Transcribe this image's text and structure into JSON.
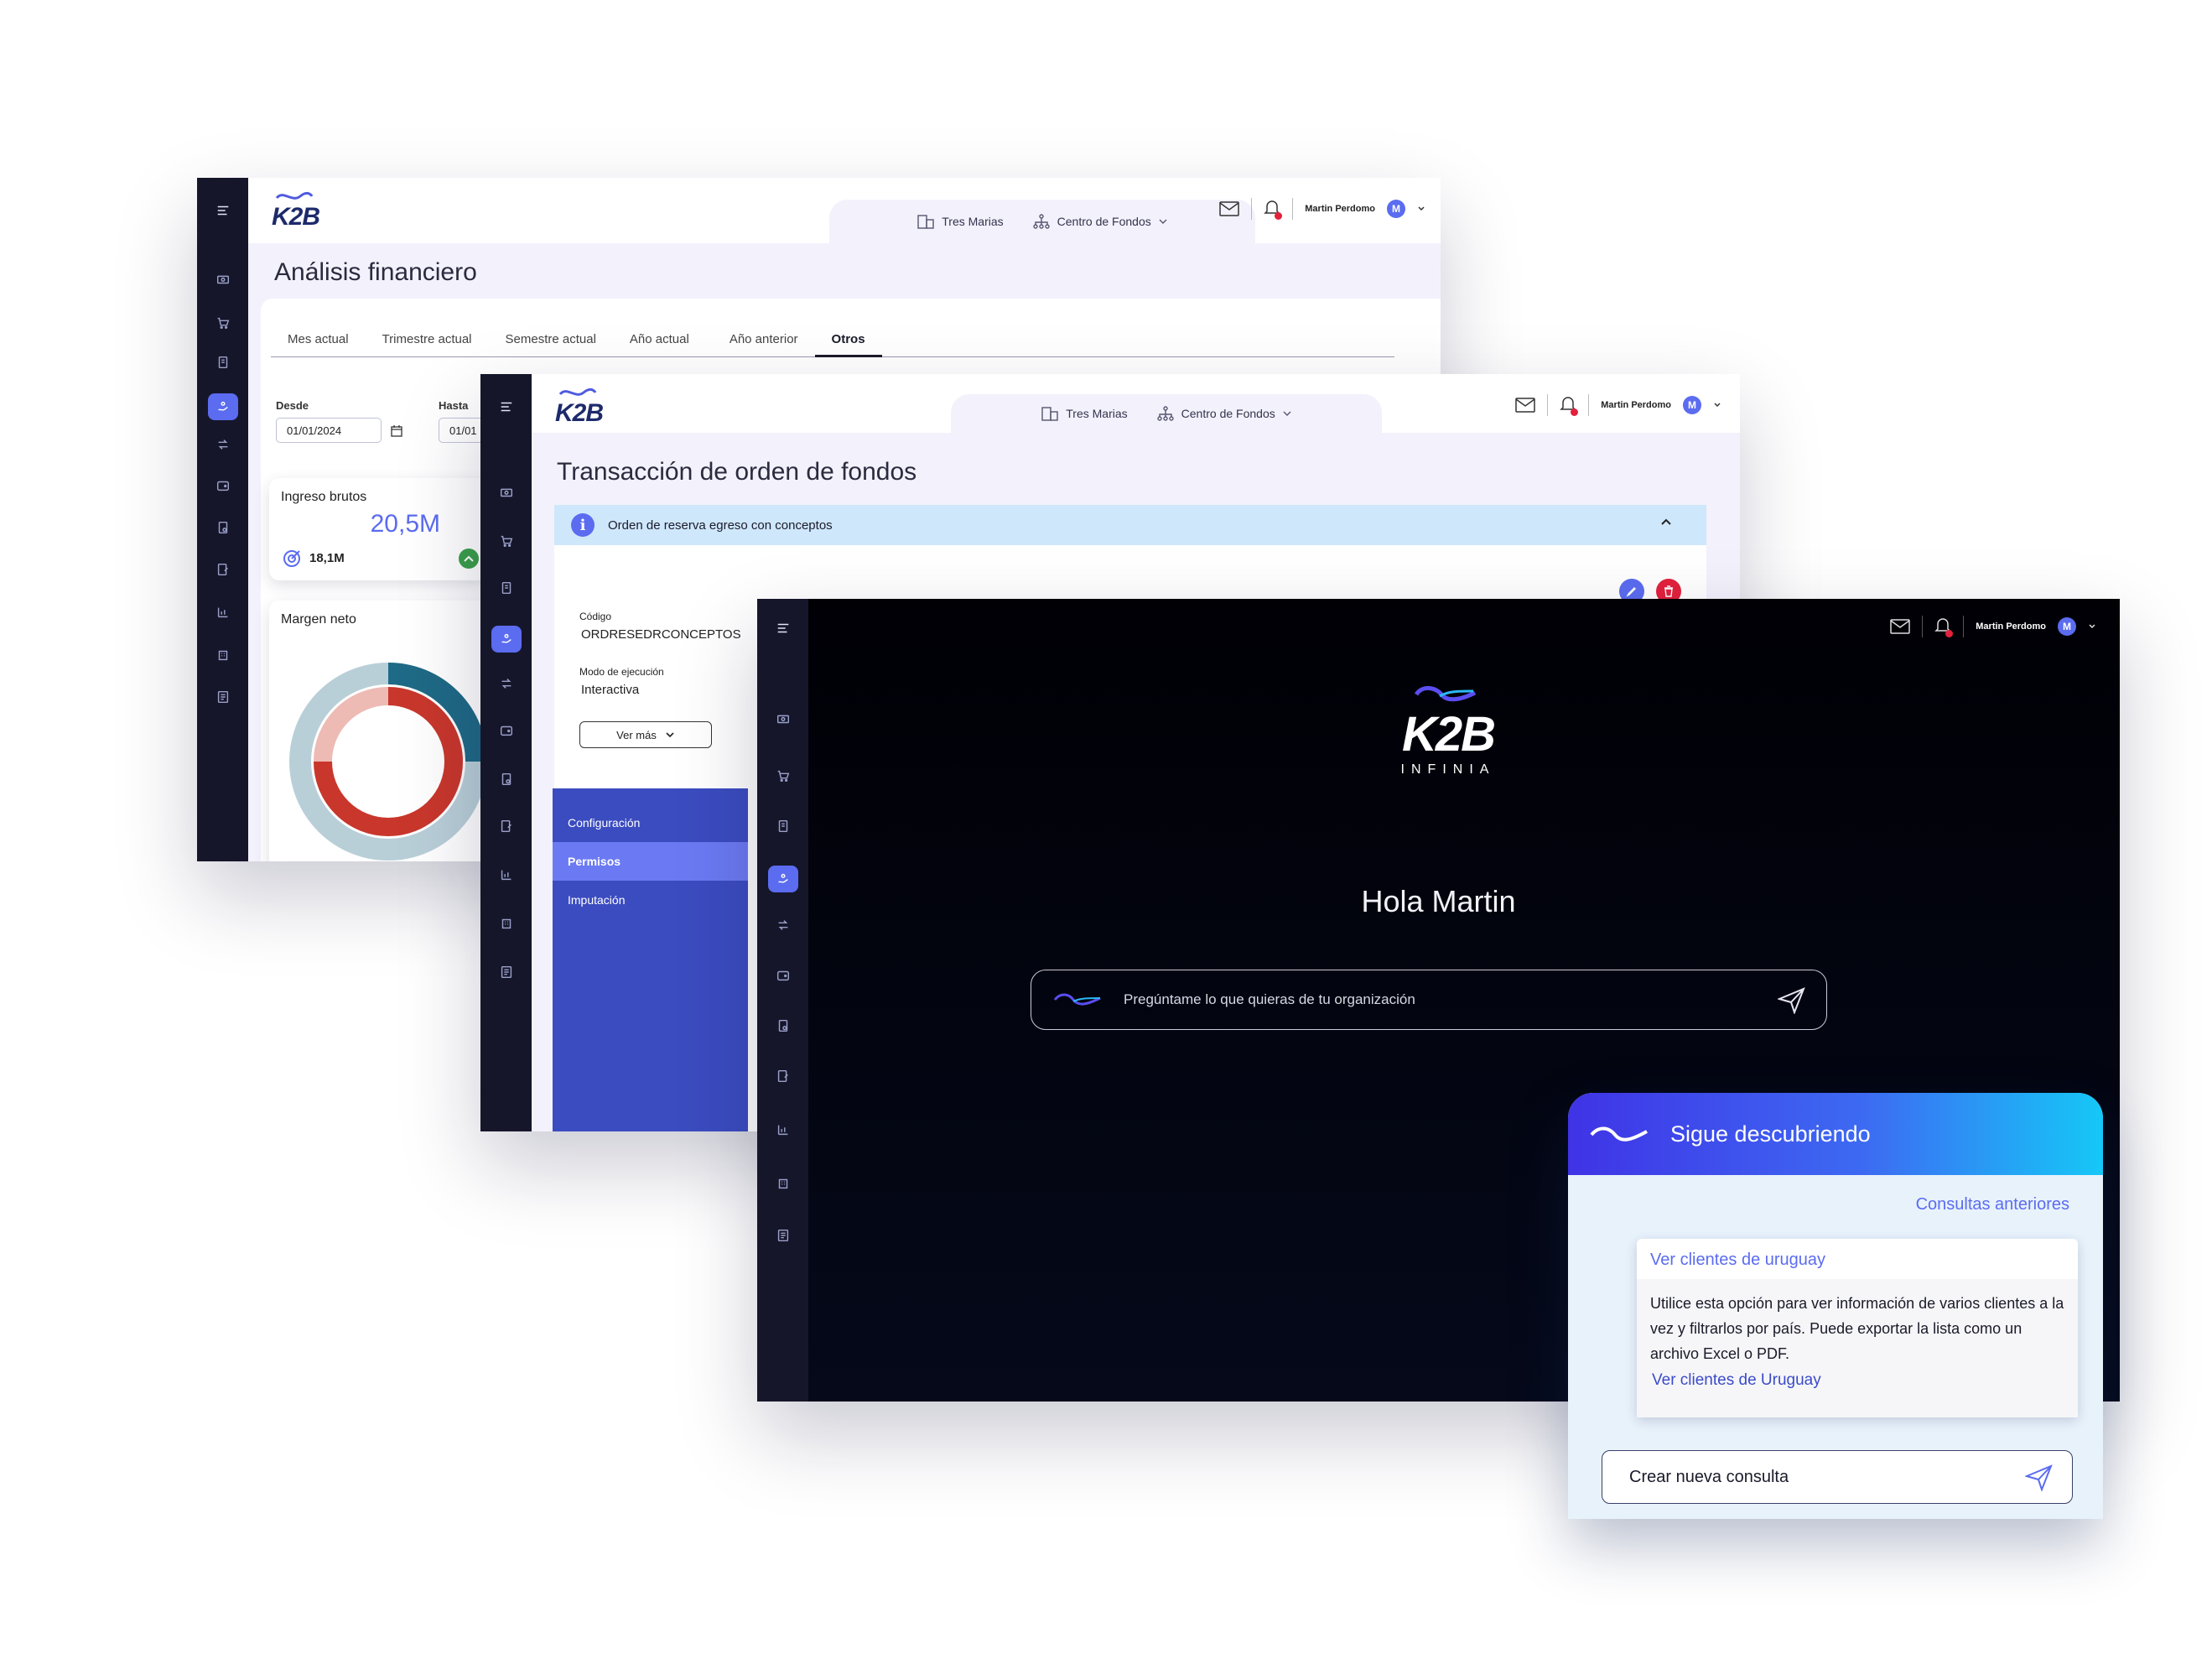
{
  "window_back": {
    "logo": "K2B",
    "company": "Tres Marias",
    "unit": "Centro de Fondos",
    "user": "Martin Perdomo",
    "avatar": "M",
    "page_title": "Análisis financiero",
    "tabs": [
      "Mes actual",
      "Trimestre actual",
      "Semestre actual",
      "Año actual",
      "Año anterior",
      "Otros"
    ],
    "selected_tab": "Otros",
    "desde_label": "Desde",
    "desde_value": "01/01/2024",
    "hasta_label": "Hasta",
    "hasta_value": "01/01",
    "card_ingreso": {
      "title": "Ingreso brutos",
      "value": "20,5M",
      "target": "18,1M"
    },
    "card_margen": {
      "title": "Margen neto"
    },
    "colors": {
      "accent": "#5b6cf0",
      "donut_red": "#c9372c",
      "donut_teal": "#1f6a86"
    }
  },
  "window_mid": {
    "logo": "K2B",
    "company": "Tres Marias",
    "unit": "Centro de Fondos",
    "user": "Martin Perdomo",
    "avatar": "M",
    "page_title": "Transacción de orden de fondos",
    "info_text": "Orden de reserva egreso con conceptos",
    "codigo_label": "Código",
    "codigo_value": "ORDRESEDRCONCEPTOS",
    "modo_label": "Modo de ejecución",
    "modo_value": "Interactiva",
    "ver_mas": "Ver más",
    "menu": [
      "Configuración",
      "Permisos",
      "Imputación"
    ],
    "selected_menu": "Permisos"
  },
  "window_front": {
    "user": "Martin Perdomo",
    "avatar": "M",
    "logo": "K2B",
    "logo_sub": "INFINIA",
    "greeting": "Hola Martin",
    "ask_placeholder": "Pregúntame lo que quieras de tu organización"
  },
  "chat": {
    "title": "Sigue descubriendo",
    "previous": "Consultas anteriores",
    "suggestion_title": "Ver clientes de uruguay",
    "suggestion_body": "Utilice esta opción para ver información de varios clientes a la vez y filtrarlos por país. Puede exportar la lista como un archivo Excel o PDF.",
    "suggestion_link": "Ver clientes de Uruguay",
    "new_query": "Crear nueva consulta"
  }
}
